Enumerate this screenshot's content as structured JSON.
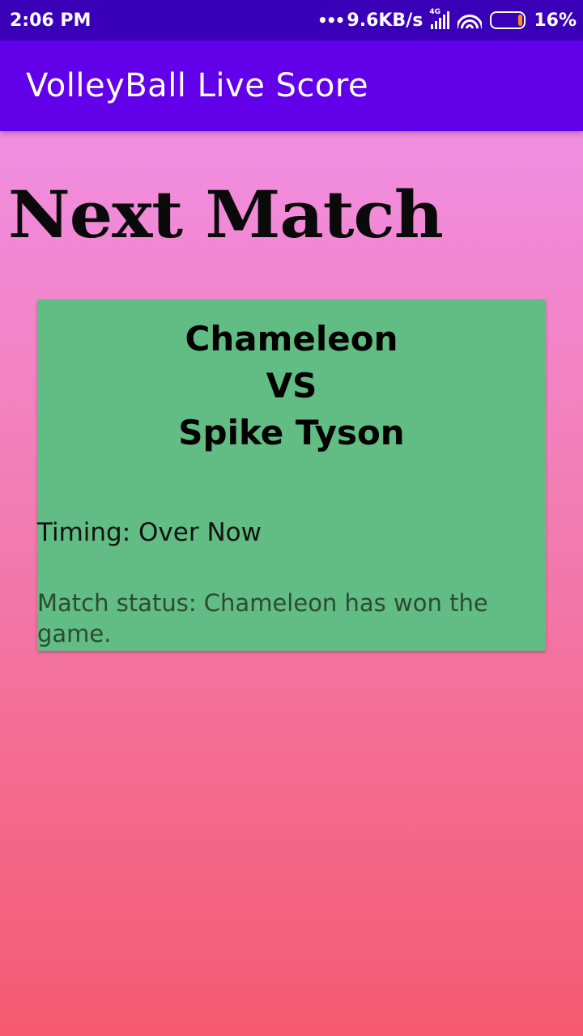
{
  "status_bar": {
    "time": "2:06 PM",
    "network_speed": "9.6KB/s",
    "network_type": "4G",
    "battery": "16%",
    "icons": [
      "signal-icon",
      "wifi-icon",
      "battery-icon"
    ],
    "battery_level": 0.16
  },
  "app_bar": {
    "title": "VolleyBall Live Score",
    "color": "#6200ea"
  },
  "page": {
    "heading": "Next Match"
  },
  "match": {
    "team1": "Chameleon",
    "vs": "VS",
    "team2": "Spike Tyson",
    "timing": "Timing: Over Now",
    "status": "Match status: Chameleon has won the game.",
    "card_color": "#61bd83"
  }
}
